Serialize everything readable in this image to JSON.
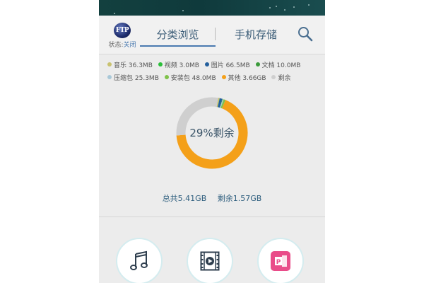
{
  "header": {
    "ftp_badge_text": "FTP",
    "ftp_status_label": "状态:",
    "ftp_status_value": "关闭",
    "tabs": [
      {
        "label": "分类浏览",
        "active": true
      },
      {
        "label": "手机存储",
        "active": false
      }
    ],
    "search_icon": "search-icon"
  },
  "legend": [
    {
      "label": "音乐",
      "value": "36.3MB",
      "color": "#c9c270"
    },
    {
      "label": "视频",
      "value": "3.0MB",
      "color": "#2bbf3a"
    },
    {
      "label": "图片",
      "value": "66.5MB",
      "color": "#245f9c"
    },
    {
      "label": "文档",
      "value": "10.0MB",
      "color": "#3a9a3a"
    },
    {
      "label": "压缩包",
      "value": "25.3MB",
      "color": "#a9c8d8"
    },
    {
      "label": "安装包",
      "value": "48.0MB",
      "color": "#7fc24a"
    },
    {
      "label": "其他",
      "value": "3.66GB",
      "color": "#f4a019"
    },
    {
      "label": "剩余",
      "value": "",
      "color": "#cfcfcf"
    }
  ],
  "chart_data": {
    "type": "pie",
    "center_label": "29%剩余",
    "categories": [
      "音乐",
      "视频",
      "图片",
      "文档",
      "压缩包",
      "安装包",
      "其他",
      "剩余"
    ],
    "values": [
      36.3,
      3.0,
      66.5,
      10.0,
      25.3,
      48.0,
      3747.8,
      1607.7
    ],
    "units": "MB"
  },
  "totals": {
    "total": "总共5.41GB",
    "remaining": "剩余1.57GB"
  },
  "categories": [
    {
      "icon": "music-note-icon"
    },
    {
      "icon": "video-film-icon"
    },
    {
      "icon": "document-icon"
    }
  ]
}
